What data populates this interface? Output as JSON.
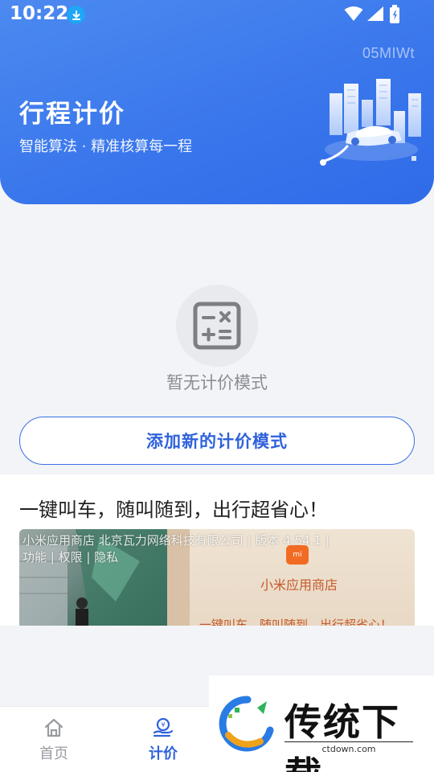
{
  "status_bar": {
    "time": "10:22"
  },
  "header": {
    "code": "05MIWt",
    "title": "行程计价",
    "subtitle": "智能算法 · 精准核算每一程"
  },
  "empty_state": {
    "text": "暂无计价模式",
    "add_button": "添加新的计价模式"
  },
  "ad": {
    "headline": "一键叫车，随叫随到，出行超省心！",
    "overlay_info": "小米应用商店 北京瓦力网络科技有限公司 | 版本 4.54.1 | 功能 | 权限 | 隐私",
    "store_name": "小米应用商店",
    "slogan": "一键叫车，随叫随到，出行超省心！",
    "logo_text": "mi"
  },
  "nav": {
    "items": [
      {
        "label": "首页",
        "icon": "home-icon",
        "active": false
      },
      {
        "label": "计价",
        "icon": "pricing-icon",
        "active": true
      }
    ]
  },
  "watermark": {
    "title": "传统下载",
    "url": "ctdown.com"
  },
  "colors": {
    "primary": "#2f62db",
    "header_gradient": "#3a77ec",
    "background": "#f3f4f7"
  }
}
